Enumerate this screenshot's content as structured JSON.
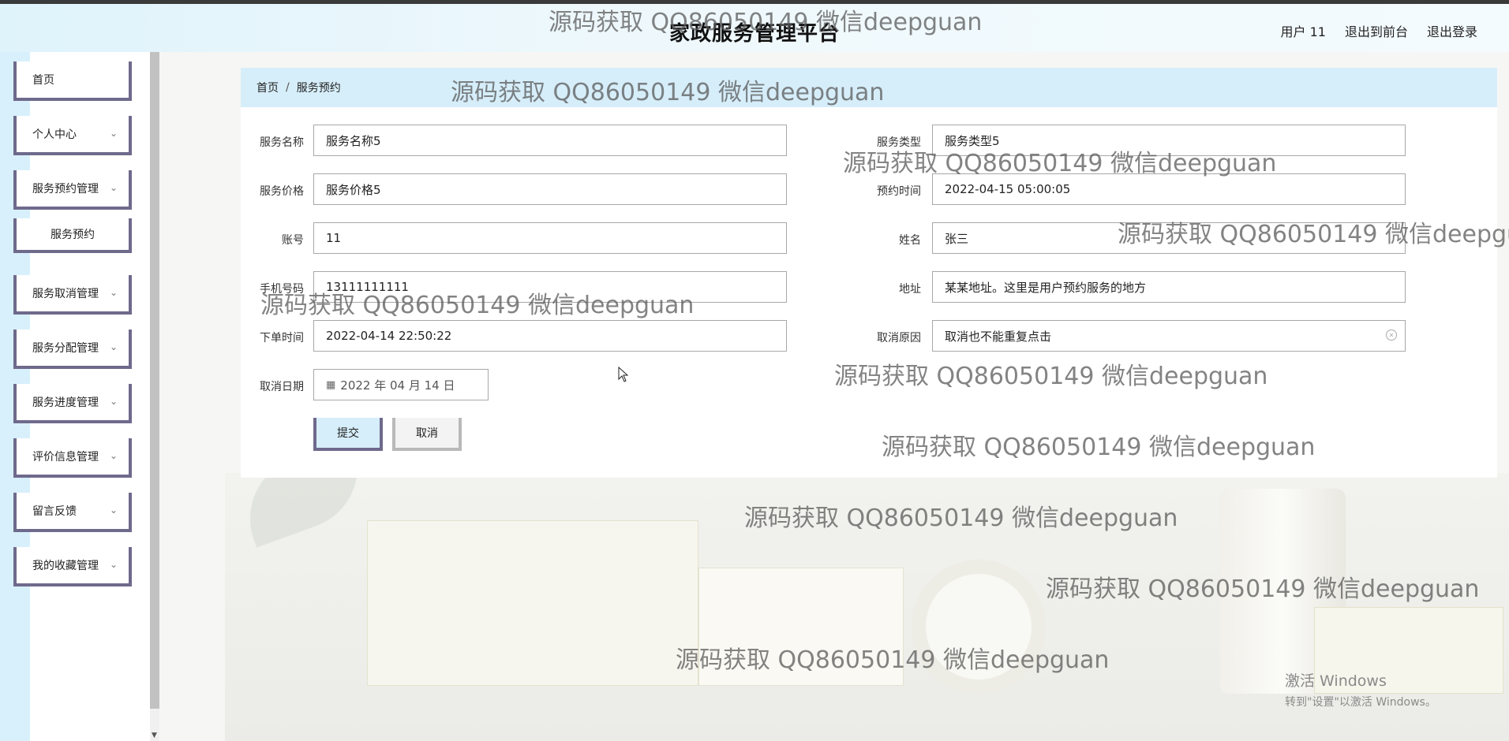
{
  "header": {
    "title": "家政服务管理平台",
    "links": [
      "用户 11",
      "退出到前台",
      "退出登录"
    ]
  },
  "sidebar": {
    "items": [
      {
        "label": "首页"
      },
      {
        "label": "个人中心"
      },
      {
        "label": "服务预约管理"
      },
      {
        "label": "服务预约"
      },
      {
        "label": "服务取消管理"
      },
      {
        "label": "服务分配管理"
      },
      {
        "label": "服务进度管理"
      },
      {
        "label": "评价信息管理"
      },
      {
        "label": "留言反馈"
      },
      {
        "label": "我的收藏管理"
      }
    ]
  },
  "breadcrumb": {
    "home": "首页",
    "separator": "/",
    "current": "服务预约"
  },
  "form": {
    "service_name_label": "服务名称",
    "service_name": "服务名称5",
    "service_type_label": "服务类型",
    "service_type": "服务类型5",
    "service_price_label": "服务价格",
    "service_price": "服务价格5",
    "appointment_time_label": "预约时间",
    "appointment_time": "2022-04-15 05:00:05",
    "account_label": "账号",
    "account": "11",
    "name_label": "姓名",
    "name": "张三",
    "phone_label": "手机号码",
    "phone": "13111111111",
    "address_label": "地址",
    "address": "某某地址。这里是用户预约服务的地方",
    "order_time_label": "下单时间",
    "order_time": "2022-04-14 22:50:22",
    "cancel_reason_label": "取消原因",
    "cancel_reason": "取消也不能重复点击",
    "cancel_date_label": "取消日期",
    "cancel_date": "2022 年 04 月 14 日",
    "submit_label": "提交",
    "cancel_label": "取消"
  },
  "watermark": "源码获取 QQ86050149 微信deepguan",
  "windows_activation": {
    "line1": "激活 Windows",
    "line2": "转到\"设置\"以激活 Windows。"
  },
  "colors": {
    "accent_light_blue": "#d6eefa",
    "border_purple": "#6e6a8c"
  }
}
